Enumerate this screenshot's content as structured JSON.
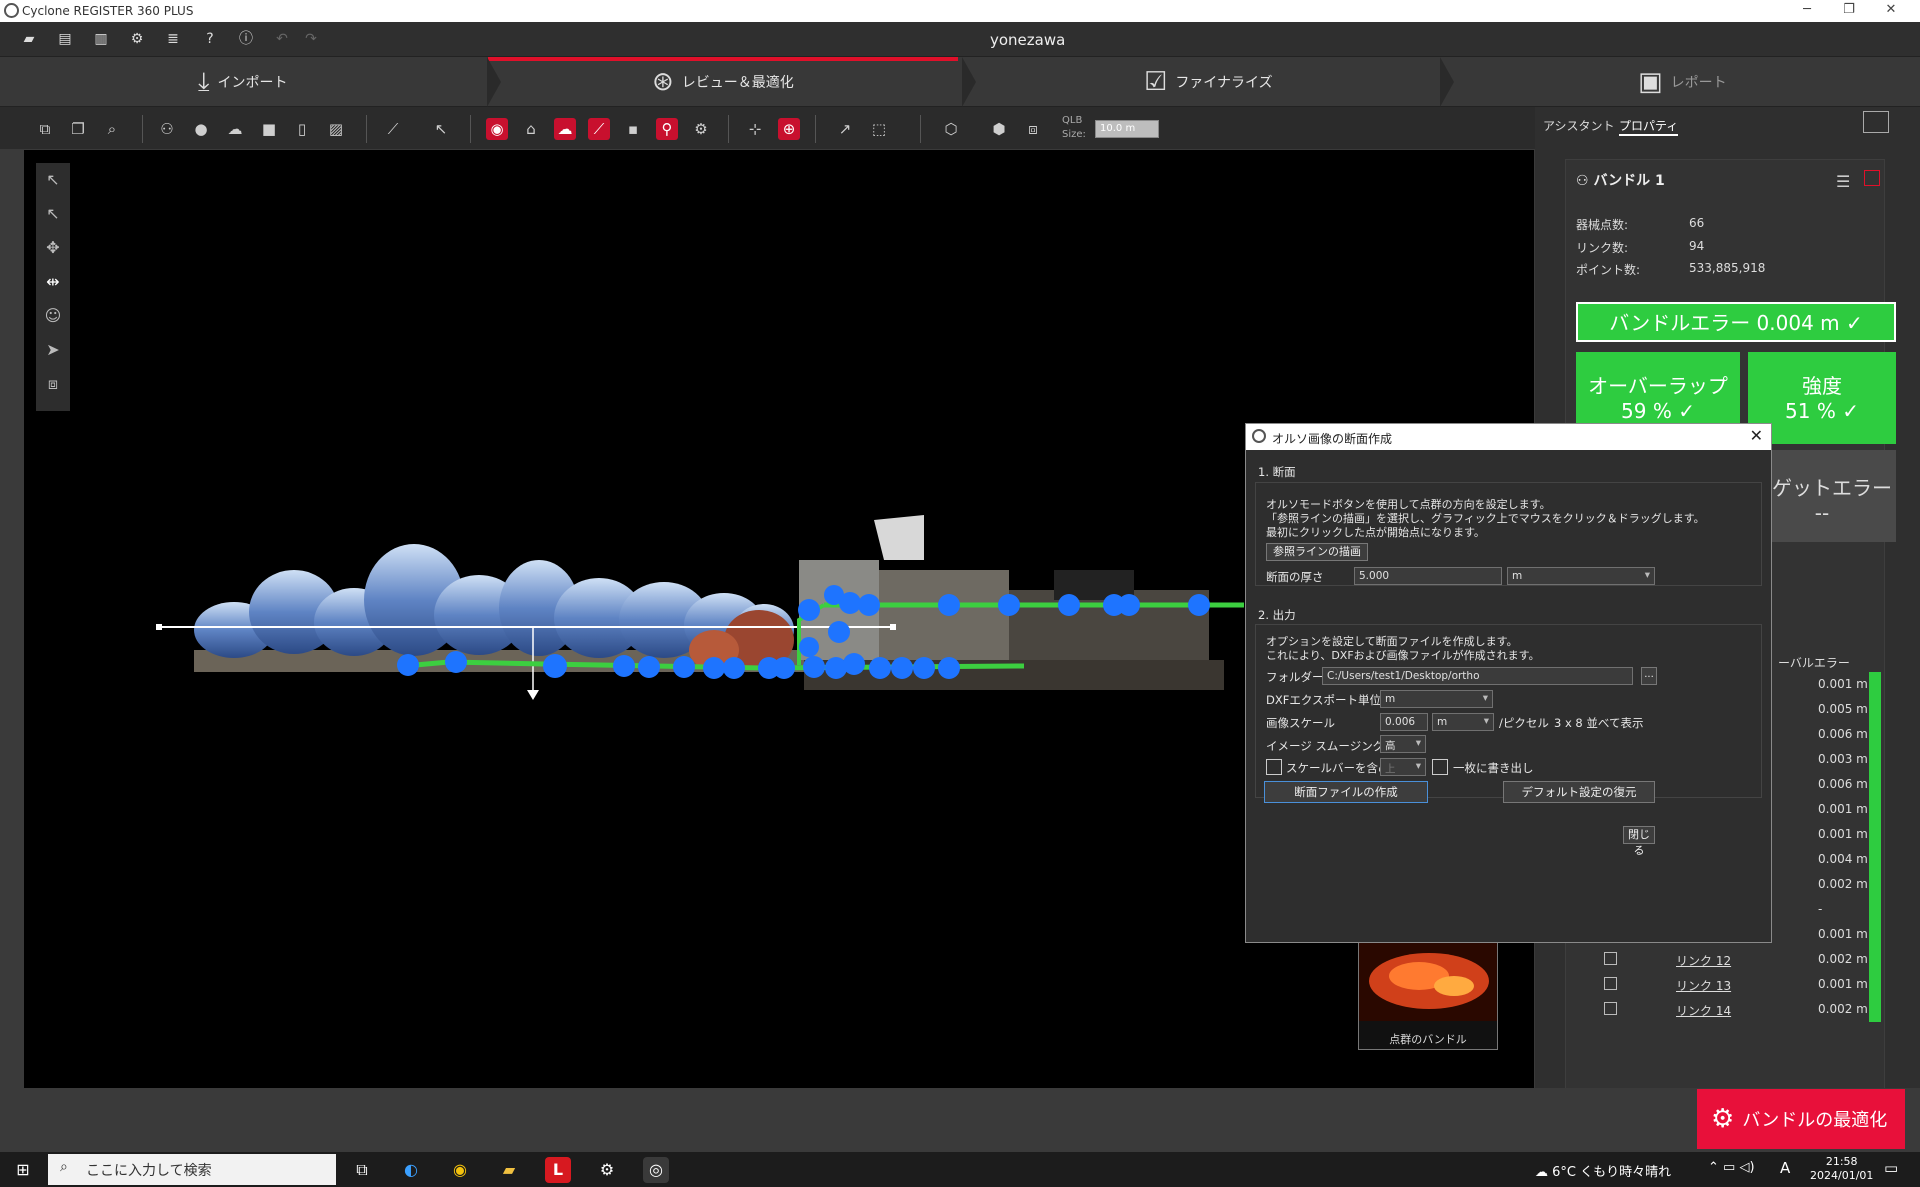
{
  "window": {
    "title": "Cyclone REGISTER 360 PLUS",
    "user": "yonezawa"
  },
  "workflow": {
    "tabs": [
      {
        "label": "インポート"
      },
      {
        "label": "レビュー＆最適化"
      },
      {
        "label": "ファイナライズ"
      },
      {
        "label": "レポート"
      }
    ]
  },
  "toolbar": {
    "qlb_label": "QLB",
    "size_label": "Size:",
    "size_value": "10.0 m"
  },
  "right_panel": {
    "tabs": [
      "アシスタント",
      "プロパティ"
    ],
    "bundle_title": "バンドル 1",
    "stats": [
      {
        "label": "器械点数:",
        "value": "66"
      },
      {
        "label": "リンク数:",
        "value": "94"
      },
      {
        "label": "ポイント数:",
        "value": "533,885,918"
      }
    ],
    "bundle_error": "バンドルエラー 0.004 m",
    "overlap_label": "オーバーラップ",
    "overlap_value": "59 %",
    "strength_label": "強度",
    "strength_value": "51 %",
    "target_error_label": "ーゲットエラー",
    "target_error_value": "--",
    "list_header": "ーバルエラー",
    "error_values": [
      "0.001 m",
      "0.005 m",
      "0.006 m",
      "0.003 m",
      "0.006 m",
      "0.001 m",
      "0.001 m",
      "0.004 m",
      "0.002 m",
      "-",
      "0.001 m"
    ],
    "links": [
      {
        "name": "リンク 12",
        "value": "0.002 m"
      },
      {
        "name": "リンク 13",
        "value": "0.001 m"
      },
      {
        "name": "リンク 14",
        "value": "0.002 m"
      }
    ]
  },
  "thumbnail": {
    "label": "点群のバンドル"
  },
  "optimize_button": "バンドルの最適化",
  "dialog": {
    "title": "オルソ画像の断面作成",
    "sec1_title": "1. 断面",
    "sec1_desc1": "オルソモードボタンを使用して点群の方向を設定します。",
    "sec1_desc2": "「参照ラインの描画」を選択し、グラフィック上でマウスをクリック＆ドラッグします。",
    "sec1_desc3": "最初にクリックした点が開始点になります。",
    "draw_ref_button": "参照ラインの描画",
    "thickness_label": "断面の厚さ",
    "thickness_value": "5.000",
    "thickness_unit": "m",
    "sec2_title": "2. 出力",
    "sec2_desc1": "オプションを設定して断面ファイルを作成します。",
    "sec2_desc2": "これにより、DXFおよび画像ファイルが作成されます。",
    "folder_label": "フォルダー",
    "folder_value": "C:/Users/test1/Desktop/ortho",
    "folder_browse": "...",
    "dxf_unit_label": "DXFエクスポート単位",
    "dxf_unit_value": "m",
    "image_scale_label": "画像スケール",
    "image_scale_value": "0.006",
    "image_scale_unit": "m",
    "per_pixel": "/ピクセル",
    "tile_text": "3 x 8 並べて表示",
    "smoothing_label": "イメージ スムージング",
    "smoothing_value": "高",
    "scalebar_label": "スケールバーを含める",
    "scalebar_pos": "上",
    "single_label": "一枚に書き出し",
    "create_button": "断面ファイルの作成",
    "restore_button": "デフォルト設定の復元",
    "close_button": "閉じる"
  },
  "taskbar": {
    "search_placeholder": "ここに入力して検索",
    "weather": "6°C くもり時々晴れ",
    "ime": "A",
    "time": "21:58",
    "date": "2024/01/01"
  }
}
